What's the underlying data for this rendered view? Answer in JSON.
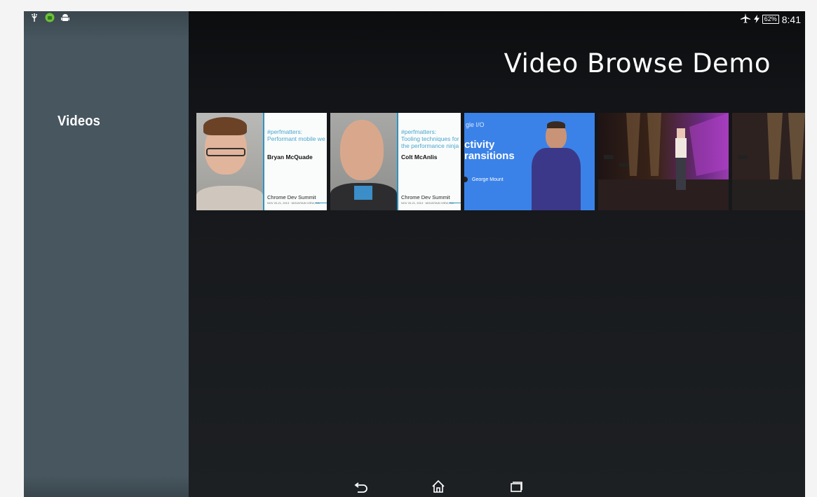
{
  "status_bar": {
    "left_icons": [
      "usb-icon",
      "android-green-icon",
      "android-icon"
    ],
    "battery": "62%",
    "time": "8:41",
    "right_icons": [
      "airplane-mode-icon",
      "charging-icon"
    ]
  },
  "sidebar": {
    "categories": [
      {
        "label": "Videos"
      }
    ]
  },
  "header": {
    "title": "Video Browse Demo"
  },
  "videos": [
    {
      "tag_line1": "#perfmatters:",
      "tag_line2": "Performant mobile we",
      "speaker": "Bryan McQuade",
      "event": "Chrome Dev Summit",
      "event_sub": "NOV 20-21, 2013 · MOUNTAIN VIEW, CA"
    },
    {
      "tag_line1": "#perfmatters:",
      "tag_line2": "Tooling techniques for",
      "tag_line3": "the performance ninja",
      "speaker": "Colt McAnlis",
      "event": "Chrome Dev Summit",
      "event_sub": "NOV 20-21, 2013 · MOUNTAIN VIEW, CA"
    },
    {
      "logo": "gle I/O",
      "title_line1": "ctivity",
      "title_line2": "ransitions",
      "speaker": "George Mount"
    },
    {},
    {}
  ],
  "navigation": {
    "back_icon": "back-icon",
    "home_icon": "home-icon",
    "recents_icon": "recent-apps-icon"
  },
  "colors": {
    "sidebar": "#47565f",
    "accent": "#2e93c3",
    "io_blue": "#3b82e8"
  }
}
